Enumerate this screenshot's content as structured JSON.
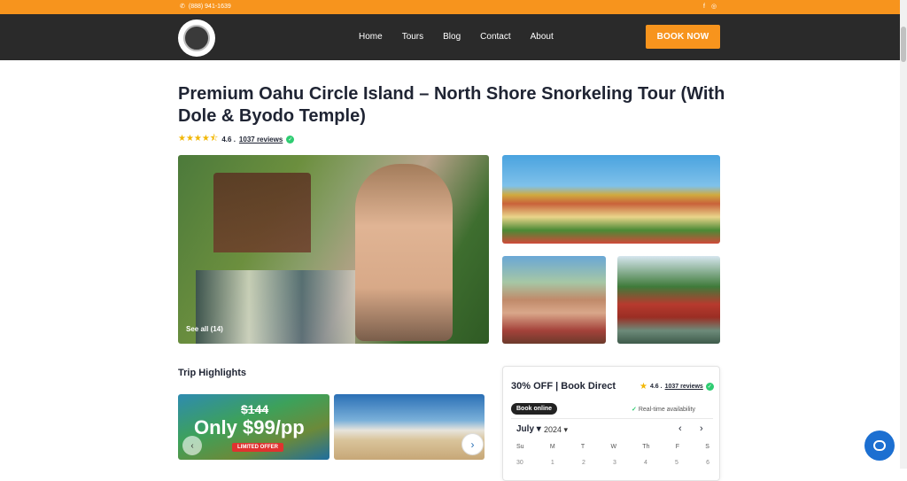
{
  "topbar": {
    "phone": "(888) 941-1639",
    "social": [
      "f",
      "◎"
    ]
  },
  "nav": {
    "items": [
      "Home",
      "Tours",
      "Blog",
      "Contact",
      "About"
    ],
    "cta": "BOOK NOW"
  },
  "title": "Premium Oahu Circle Island – North Shore Snorkeling Tour (With Dole & Byodo Temple)",
  "rating": {
    "stars": "★★★★⯪",
    "value": "4.6 .",
    "reviews": "1037 reviews"
  },
  "gallery": {
    "see_all": "See all (14)"
  },
  "highlights": {
    "title": "Trip Highlights",
    "old_price": "$144",
    "promo": "Only $99/pp",
    "badge": "LIMITED OFFER"
  },
  "booking": {
    "title": "30% OFF | Book Direct",
    "rating_value": "4.6 .",
    "reviews": "1037 reviews",
    "pill": "Book online",
    "realtime": "Real-time availability",
    "month": "July ▾",
    "year": "2024 ▾",
    "weekdays": [
      "Su",
      "M",
      "T",
      "W",
      "Th",
      "F",
      "S"
    ],
    "dates": [
      "30",
      "1",
      "2",
      "3",
      "4",
      "5",
      "6"
    ]
  },
  "colors": {
    "accent": "#f7941d",
    "nav_bg": "#2a2a2a",
    "check": "#2ecc71",
    "chat": "#1c6fd1"
  }
}
